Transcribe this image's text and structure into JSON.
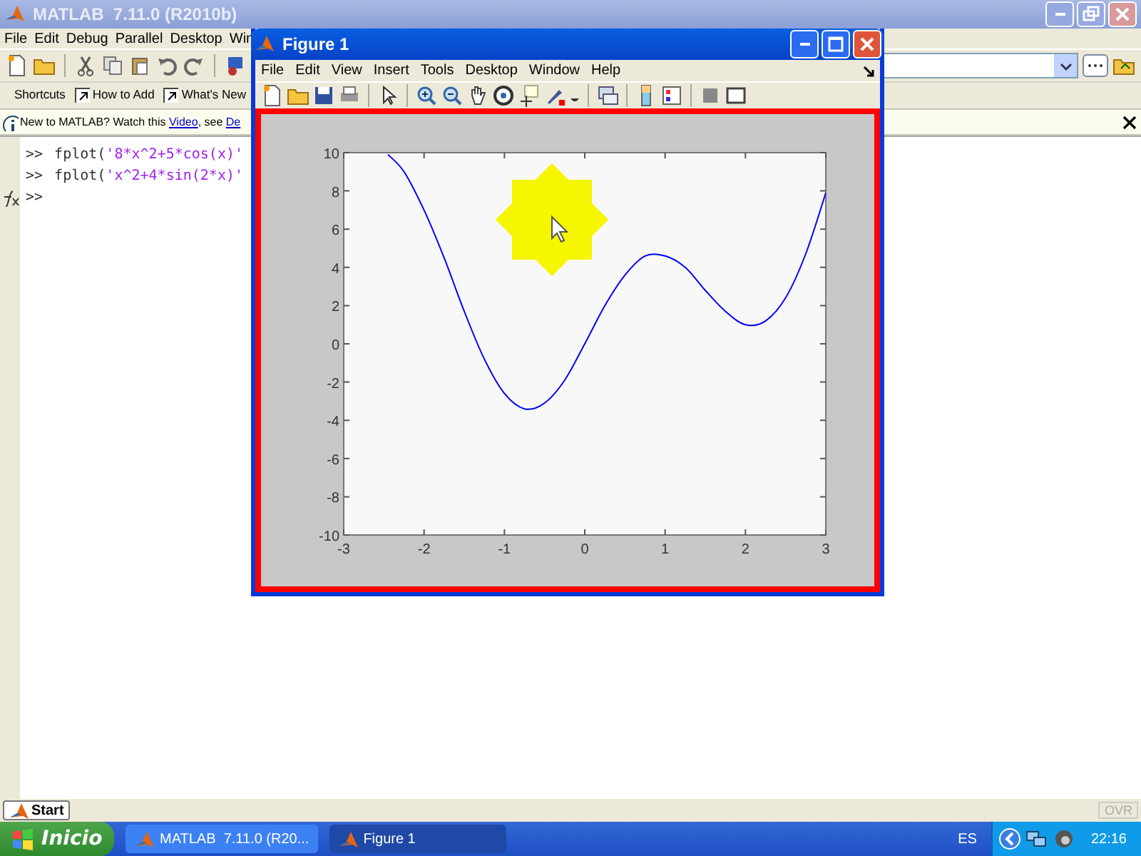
{
  "matlab_window": {
    "title": "MATLAB  7.11.0 (R2010b)",
    "menu": [
      "File",
      "Edit",
      "Debug",
      "Parallel",
      "Desktop",
      "Win"
    ],
    "shortcuts": [
      {
        "kind": "plain",
        "label": "Shortcuts"
      },
      {
        "kind": "link",
        "label": "How to Add"
      },
      {
        "kind": "link",
        "label": "What's New"
      }
    ],
    "info_bar": {
      "before": "New to MATLAB? Watch this ",
      "link": "Video",
      "after": ", see ",
      "cut_link": "De"
    },
    "command_window": {
      "lines": [
        {
          "prompt": ">>",
          "code": "fplot(",
          "string": "'8*x^2+5*cos(x)'"
        },
        {
          "prompt": ">>",
          "code": "fplot(",
          "string": "'x^2+4*sin(2*x)'"
        },
        {
          "prompt": ">>"
        }
      ]
    },
    "status_bar": {
      "start": "Start",
      "mode": "OVR"
    }
  },
  "figure_window": {
    "title": "Figure 1",
    "menu": [
      "File",
      "Edit",
      "View",
      "Insert",
      "Tools",
      "Desktop",
      "Window",
      "Help"
    ],
    "highlighted": true,
    "star_overlay": true,
    "chart_data": {
      "type": "line",
      "x": [
        -2.45,
        -2.25,
        -2,
        -1.75,
        -1.5,
        -1.25,
        -1,
        -0.75,
        -0.5,
        -0.25,
        0,
        0.25,
        0.5,
        0.75,
        1,
        1.25,
        1.5,
        1.75,
        2,
        2.25,
        2.5,
        2.75,
        3
      ],
      "series": [
        {
          "color": "#0000ff",
          "values": [
            9.9,
            9,
            7,
            4.5,
            1.7,
            -0.8,
            -2.6,
            -3.4,
            -3.1,
            -1.9,
            0,
            2,
            3.6,
            4.6,
            4.6,
            4,
            2.8,
            1.7,
            1,
            1.2,
            2.4,
            4.7,
            7.9
          ]
        }
      ],
      "xlim": [
        -3,
        3
      ],
      "ylim": [
        -10,
        10
      ],
      "xticks": [
        -3,
        -2,
        -1,
        0,
        1,
        2,
        3
      ],
      "yticks": [
        -10,
        -8,
        -6,
        -4,
        -2,
        0,
        2,
        4,
        6,
        8,
        10
      ]
    }
  },
  "taskbar": {
    "start": "Inicio",
    "tasks": [
      {
        "label": "MATLAB  7.11.0 (R20...",
        "selected": false
      },
      {
        "label": "Figure 1",
        "selected": true
      }
    ],
    "language": "ES",
    "clock": "22:16"
  }
}
